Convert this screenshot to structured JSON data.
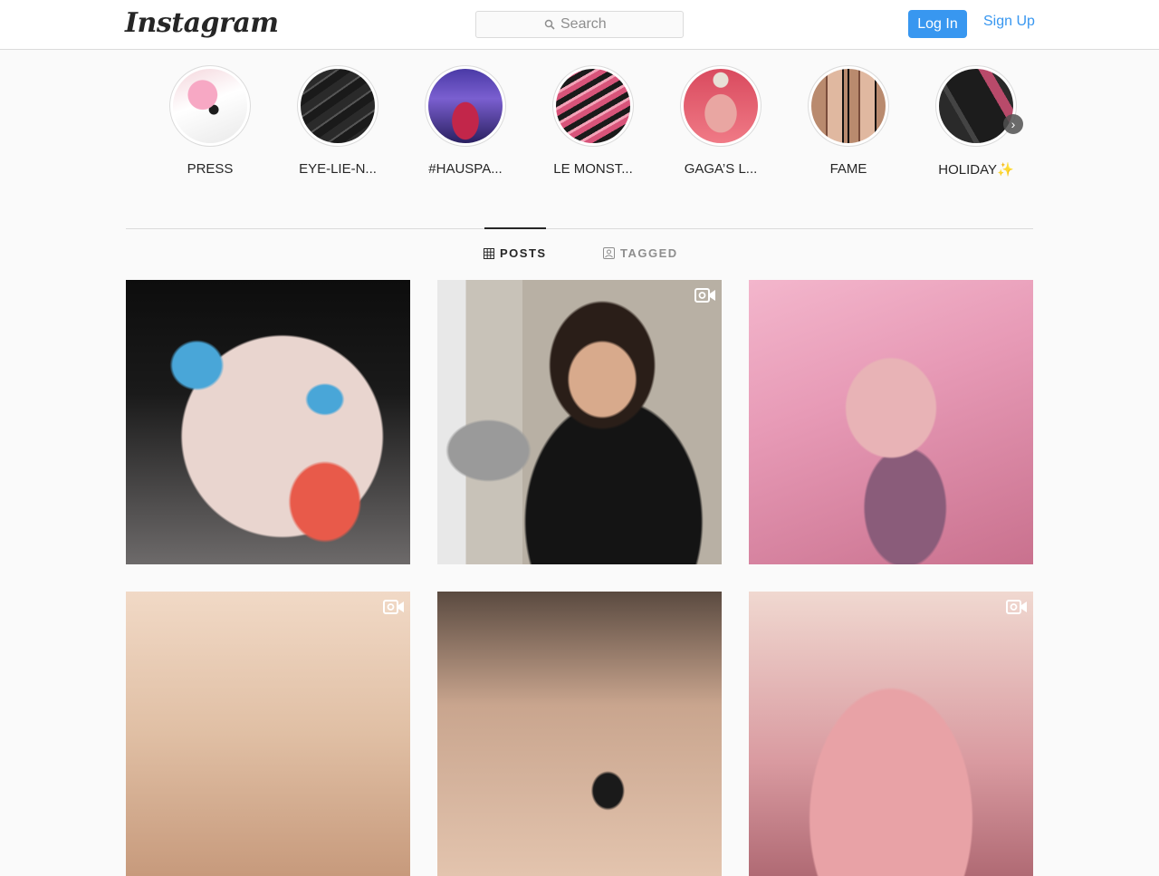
{
  "header": {
    "logo": "Instagram",
    "search_placeholder": "Search",
    "login_label": "Log In",
    "signup_label": "Sign Up"
  },
  "highlights": [
    {
      "label": "PRESS"
    },
    {
      "label": "EYE-LIE-N..."
    },
    {
      "label": "#HAUSPA..."
    },
    {
      "label": "LE MONST..."
    },
    {
      "label": "GAGA’S L..."
    },
    {
      "label": "FAME"
    },
    {
      "label": "HOLIDAY✨"
    }
  ],
  "tabs": {
    "posts": "POSTS",
    "tagged": "TAGGED"
  },
  "colors": {
    "accent": "#3897f0",
    "border": "#dbdbdb",
    "text": "#262626",
    "muted": "#8e8e8e"
  }
}
